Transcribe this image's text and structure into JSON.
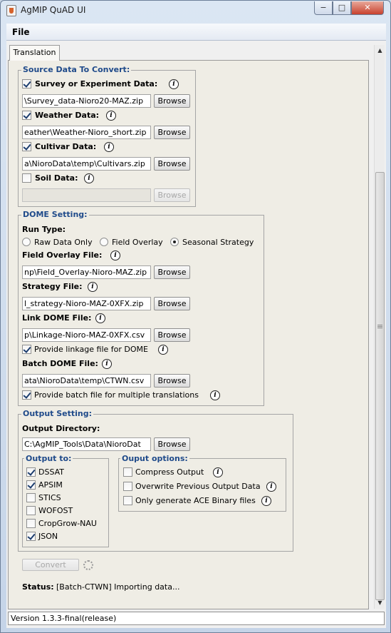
{
  "window": {
    "title": "AgMIP QuAD UI",
    "minimize": "−",
    "maximize": "□",
    "close": "✕"
  },
  "menu": {
    "file": "File"
  },
  "tabs": [
    "Translation"
  ],
  "source": {
    "title": "Source Data To Convert:",
    "survey": {
      "label": "Survey or Experiment Data:",
      "checked": true,
      "path": "\\Survey_data-Nioro20-MAZ.zip",
      "browse": "Browse"
    },
    "weather": {
      "label": "Weather Data:",
      "checked": true,
      "path": "eather\\Weather-Nioro_short.zip",
      "browse": "Browse"
    },
    "cultivar": {
      "label": "Cultivar Data:",
      "checked": true,
      "path": "a\\NioroData\\temp\\Cultivars.zip",
      "browse": "Browse"
    },
    "soil": {
      "label": "Soil Data:",
      "checked": false,
      "path": "",
      "browse": "Browse"
    }
  },
  "dome": {
    "title": "DOME Setting:",
    "run_type_label": "Run Type:",
    "run_types": [
      "Raw Data Only",
      "Field Overlay",
      "Seasonal Strategy"
    ],
    "selected_run_type": "Seasonal Strategy",
    "field_overlay": {
      "label": "Field Overlay File:",
      "path": "np\\Field_Overlay-Nioro-MAZ.zip",
      "browse": "Browse"
    },
    "strategy": {
      "label": "Strategy File:",
      "path": "l_strategy-Nioro-MAZ-0XFX.zip",
      "browse": "Browse"
    },
    "link": {
      "label": "Link DOME File:",
      "path": "p\\Linkage-Nioro-MAZ-0XFX.csv",
      "browse": "Browse",
      "provide_label": "Provide linkage file for DOME",
      "provide_checked": true
    },
    "batch": {
      "label": "Batch DOME File:",
      "path": "ata\\NioroData\\temp\\CTWN.csv",
      "browse": "Browse",
      "provide_label": "Provide batch file for multiple translations",
      "provide_checked": true
    }
  },
  "output": {
    "title": "Output Setting:",
    "dir_label": "Output Directory:",
    "dir_path": "C:\\AgMIP_Tools\\Data\\NioroDat",
    "browse": "Browse",
    "output_to_title": "Output to:",
    "models": [
      {
        "label": "DSSAT",
        "checked": true
      },
      {
        "label": "APSIM",
        "checked": true
      },
      {
        "label": "STICS",
        "checked": false
      },
      {
        "label": "WOFOST",
        "checked": false
      },
      {
        "label": "CropGrow-NAU",
        "checked": false
      },
      {
        "label": "JSON",
        "checked": true
      }
    ],
    "options_title": "Ouput options:",
    "options": [
      {
        "label": "Compress Output",
        "checked": false
      },
      {
        "label": "Overwrite Previous Output Data",
        "checked": false
      },
      {
        "label": "Only generate ACE Binary files",
        "checked": false
      }
    ]
  },
  "convert_label": "Convert",
  "status": {
    "label": "Status:",
    "text": "[Batch-CTWN] Importing data..."
  },
  "version": "Version 1.3.3-final(release)",
  "info_glyph": "i",
  "colors": {
    "group_title": "#1f4a8a",
    "panel": "#efede5"
  }
}
